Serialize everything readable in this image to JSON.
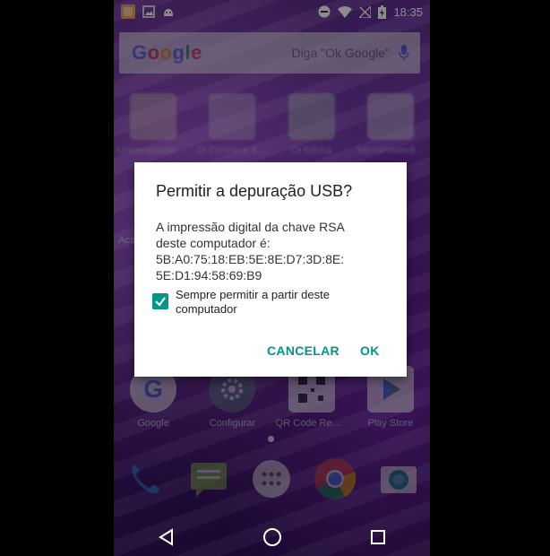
{
  "status_bar": {
    "time": "18:35"
  },
  "search": {
    "logo": "Google",
    "hint": "Diga \"Ok Google\""
  },
  "home": {
    "row1": [
      {
        "label": "Universidade A..."
      },
      {
        "label": "Oi Conhece 83..."
      },
      {
        "label": "Oi Educa"
      },
      {
        "label": "MicroPowerB..."
      }
    ],
    "row1_partial_label": "Aca",
    "row2": [
      {
        "label": "Google"
      },
      {
        "label": "Configurar"
      },
      {
        "label": "QR Code Read..."
      },
      {
        "label": "Play Store"
      }
    ],
    "dock": [
      "phone-icon",
      "messages-icon",
      "app-drawer-icon",
      "chrome-icon",
      "camera-icon"
    ]
  },
  "dialog": {
    "title": "Permitir a depuração USB?",
    "body_line1": "A impressão digital da chave RSA",
    "body_line2": "deste computador é:",
    "body_line3": "5B:A0:75:18:EB:5E:8E:D7:3D:8E:",
    "body_line4": "5E:D1:94:58:69:B9",
    "checkbox_label": "Sempre permitir a partir deste computador",
    "checkbox_checked": true,
    "cancel_label": "CANCELAR",
    "ok_label": "OK",
    "accent_color": "#009688"
  }
}
